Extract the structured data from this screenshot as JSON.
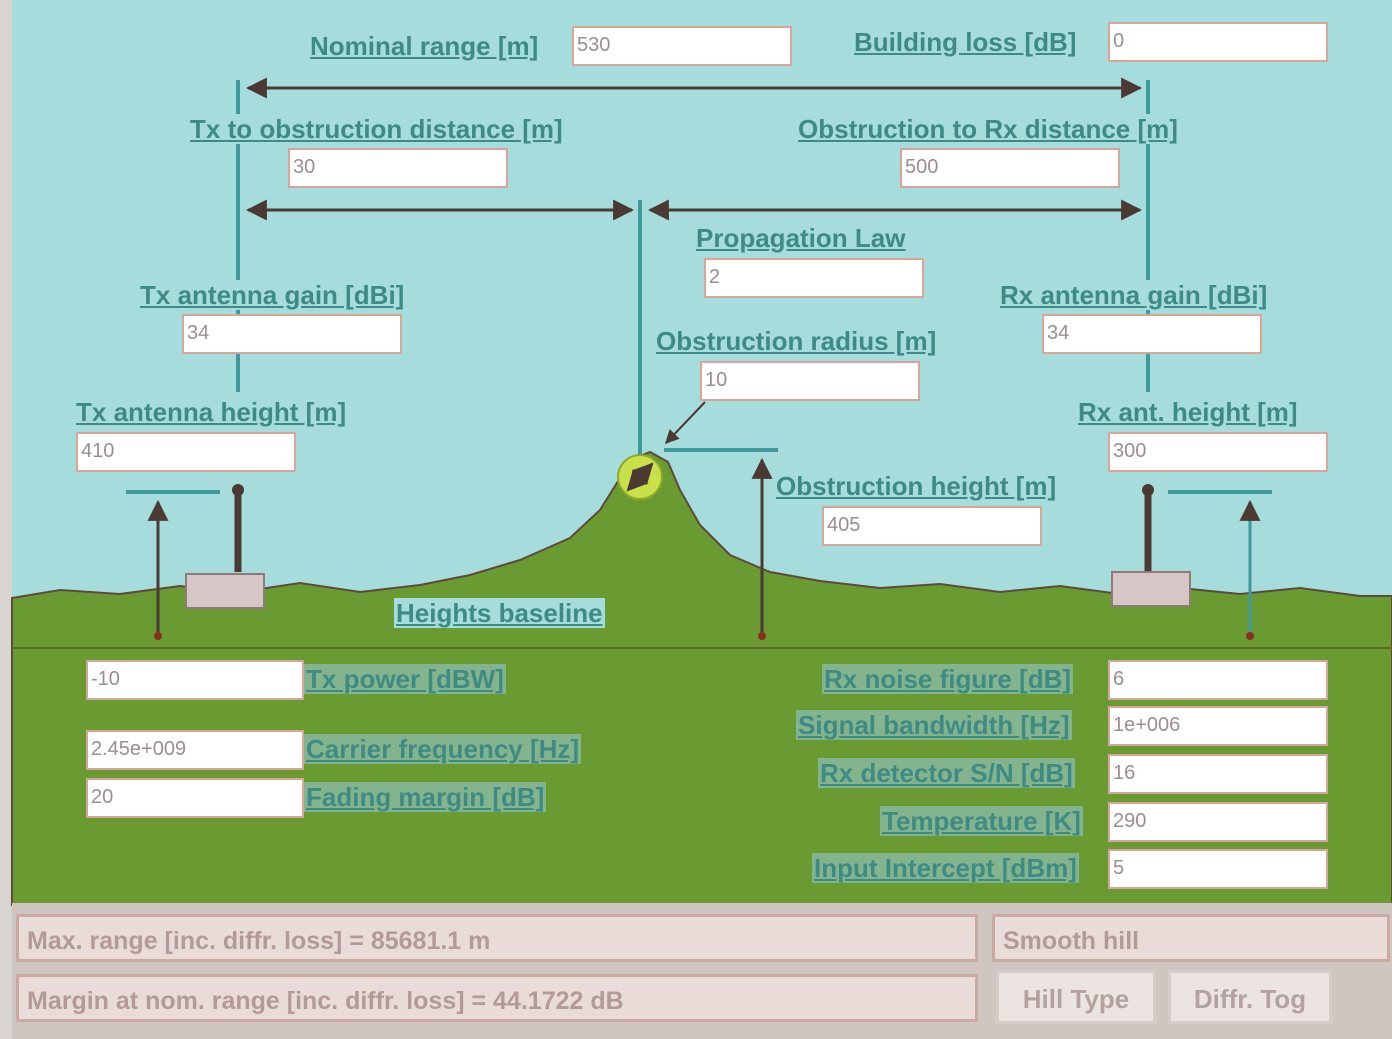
{
  "labels": {
    "nominal_range": "Nominal range [m]",
    "building_loss": "Building loss [dB]",
    "tx_obstruction_distance": "Tx to obstruction distance [m]",
    "obstruction_rx_distance": "Obstruction to Rx distance [m]",
    "propagation_law": "Propagation Law",
    "tx_antenna_gain": "Tx antenna gain [dBi]",
    "rx_antenna_gain": "Rx antenna gain [dBi]",
    "obstruction_radius": "Obstruction radius [m]",
    "tx_antenna_height": "Tx antenna height [m]",
    "rx_antenna_height": "Rx ant. height [m]",
    "obstruction_height": "Obstruction height [m]",
    "heights_baseline": "Heights baseline",
    "tx_power": "Tx power [dBW]",
    "carrier_frequency": "Carrier frequency [Hz]",
    "fading_margin": "Fading margin [dB]",
    "rx_noise_figure": "Rx noise figure [dB]",
    "signal_bandwidth": "Signal bandwidth [Hz]",
    "rx_detector_sn": "Rx detector S/N [dB]",
    "temperature": "Temperature [K]",
    "input_intercept": "Input Intercept [dBm]"
  },
  "fields": {
    "nominal_range": "530",
    "building_loss": "0",
    "tx_obstruction_distance": "30",
    "obstruction_rx_distance": "500",
    "propagation_law": "2",
    "tx_antenna_gain": "34",
    "rx_antenna_gain": "34",
    "obstruction_radius": "10",
    "tx_antenna_height": "410",
    "rx_antenna_height": "300",
    "obstruction_height": "405",
    "tx_power": "-10",
    "carrier_frequency": "2.45e+009",
    "fading_margin": "20",
    "rx_noise_figure": "6",
    "signal_bandwidth": "1e+006",
    "rx_detector_sn": "16",
    "temperature": "290",
    "input_intercept": "5"
  },
  "status": {
    "max_range": "Max. range [inc. diffr. loss] =     85681.1 m",
    "margin": "Margin at nom. range [inc. diffr. loss] =     44.1722 dB",
    "hill_type_value": "Smooth hill"
  },
  "buttons": {
    "hill_type": "Hill Type",
    "diffr_tog": "Diffr. Tog"
  },
  "colors": {
    "sky": "#a6dcdc",
    "ground": "#6a9b33",
    "line": "#3e9a9a",
    "dark_line": "#4b3a34"
  }
}
